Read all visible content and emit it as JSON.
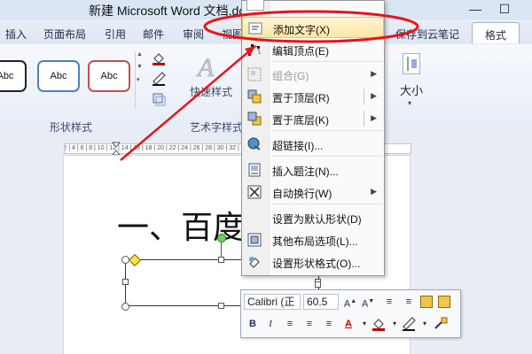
{
  "window": {
    "title": "新建 Microsoft Word 文档.do"
  },
  "tabs": [
    {
      "label": "插入"
    },
    {
      "label": "页面布局"
    },
    {
      "label": "引用"
    },
    {
      "label": "邮件"
    },
    {
      "label": "审阅"
    },
    {
      "label": "视图"
    },
    {
      "label": "保存到云笔记"
    },
    {
      "label": "格式"
    }
  ],
  "ribbon": {
    "shape_styles": [
      {
        "label": "Abc"
      },
      {
        "label": "Abc"
      },
      {
        "label": "Abc"
      }
    ],
    "quick_styles_label": "快速样式",
    "art_text_group_label": "艺术字样式",
    "shape_styles_group_label": "形状样式",
    "size_label": "大小"
  },
  "ruler": {
    "ticks": "8 | 6 | 4 | 2 | 2 | 4 | 6 | 8 | 10 | 12 | 14 | 16 | 18 | 20 | 22 | 24 | 26 | 28 | 30 | 32 | 34 | 36 | 38 | 40 | 42 | 44 | 46 | 48"
  },
  "document": {
    "heading": "一、百度"
  },
  "context_menu": {
    "items": [
      {
        "label": "添加文字(X)",
        "icon": "add-text-icon",
        "highlighted": true
      },
      {
        "label": "编辑顶点(E)",
        "icon": "edit-points-icon"
      },
      {
        "label": "组合(G)",
        "icon": "group-icon",
        "disabled": true,
        "submenu": true
      },
      {
        "label": "置于顶层(R)",
        "icon": "bring-to-front-icon",
        "submenu": true
      },
      {
        "label": "置于底层(K)",
        "icon": "send-to-back-icon",
        "submenu": true
      },
      {
        "label": "超链接(I)...",
        "icon": "hyperlink-icon"
      },
      {
        "label": "插入题注(N)...",
        "icon": "insert-caption-icon"
      },
      {
        "label": "自动换行(W)",
        "icon": "text-wrap-icon",
        "submenu": true
      },
      {
        "label": "设置为默认形状(D)",
        "icon": ""
      },
      {
        "label": "其他布局选项(L)...",
        "icon": "layout-options-icon"
      },
      {
        "label": "设置形状格式(O)...",
        "icon": "format-shape-icon"
      }
    ]
  },
  "mini_toolbar": {
    "font": "Calibri (正",
    "size": "60.5",
    "buttons": [
      "B",
      "I"
    ]
  },
  "annotation": {
    "circle_color": "#e8141b",
    "arrow_color": "#e8141b"
  }
}
